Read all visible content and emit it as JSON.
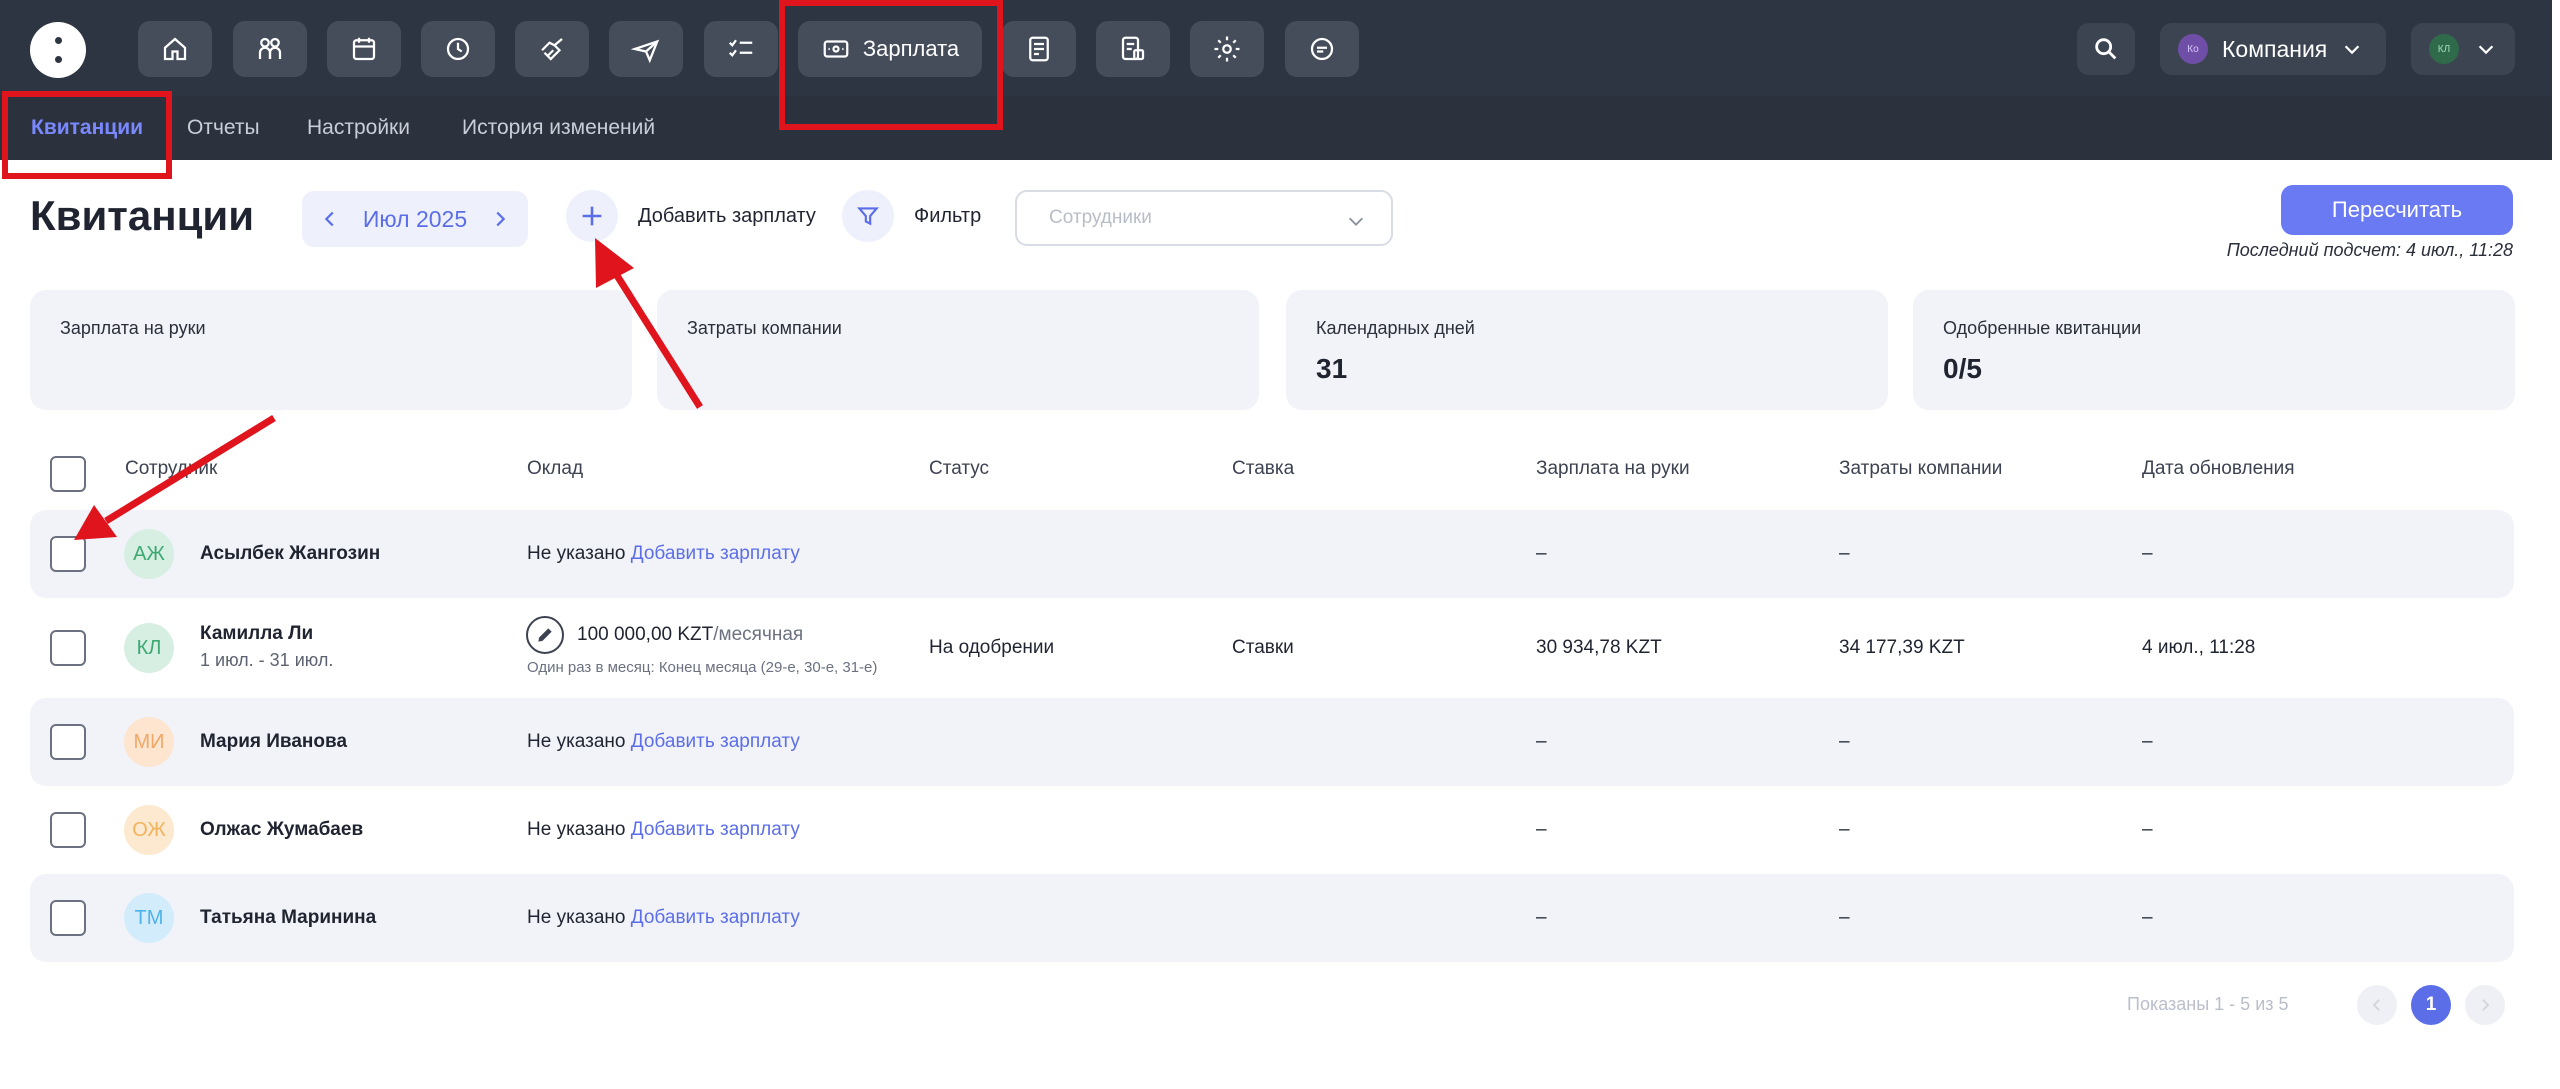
{
  "topnav": {
    "active_label": "Зарплата",
    "company_label": "Компания",
    "company_initials": "Ко",
    "user_initials": "КЛ",
    "icons": [
      "home-icon",
      "people-icon",
      "calendar-icon",
      "clock-icon",
      "handshake-icon",
      "plane-icon",
      "checklist-icon",
      "salary-icon",
      "document-icon",
      "reports-icon",
      "gear-icon",
      "chat-icon"
    ]
  },
  "subnav": {
    "tabs": [
      "Квитанции",
      "Отчеты",
      "Настройки",
      "История изменений"
    ]
  },
  "page": {
    "title": "Квитанции",
    "month": "Июл 2025",
    "add_salary": "Добавить зарплату",
    "filter": "Фильтр",
    "employees_placeholder": "Сотрудники",
    "recalc": "Пересчитать",
    "last_calc": "Последний подсчет: 4 июл., 11:28"
  },
  "stats": [
    {
      "label": "Зарплата на руки",
      "value": ""
    },
    {
      "label": "Затраты компании",
      "value": ""
    },
    {
      "label": "Календарных дней",
      "value": "31"
    },
    {
      "label": "Одобренные квитанции",
      "value": "0/5"
    }
  ],
  "table": {
    "headers": [
      "Сотрудник",
      "Оклад",
      "Статус",
      "Ставка",
      "Зарплата на руки",
      "Затраты компании",
      "Дата обновления"
    ],
    "rows": [
      {
        "initials": "АЖ",
        "name": "Асылбек Жангозин",
        "period": "",
        "salary_status": "Не указано",
        "salary_link": "Добавить зарплату",
        "salary_amount": "",
        "salary_unit": "",
        "salary_note": "",
        "status": "",
        "rate": "",
        "net": "–",
        "cost": "–",
        "updated": "–",
        "avatar_bg": "#d6efe2",
        "avatar_fg": "#3ea872"
      },
      {
        "initials": "КЛ",
        "name": "Камилла Ли",
        "period": "1 июл. - 31 июл.",
        "salary_status": "",
        "salary_link": "",
        "salary_amount": "100 000,00 KZT",
        "salary_unit": "/месячная",
        "salary_note": "Один раз в месяц: Конец месяца (29-е, 30-е, 31-е)",
        "status": "На одобрении",
        "rate": "Ставки",
        "net": "30 934,78 KZT",
        "cost": "34 177,39 KZT",
        "updated": "4 июл., 11:28",
        "avatar_bg": "#d6efe2",
        "avatar_fg": "#3ea872"
      },
      {
        "initials": "МИ",
        "name": "Мария Иванова",
        "period": "",
        "salary_status": "Не указано",
        "salary_link": "Добавить зарплату",
        "salary_amount": "",
        "salary_unit": "",
        "salary_note": "",
        "status": "",
        "rate": "",
        "net": "–",
        "cost": "–",
        "updated": "–",
        "avatar_bg": "#fde5cf",
        "avatar_fg": "#f0a868"
      },
      {
        "initials": "ОЖ",
        "name": "Олжас Жумабаев",
        "period": "",
        "salary_status": "Не указано",
        "salary_link": "Добавить зарплату",
        "salary_amount": "",
        "salary_unit": "",
        "salary_note": "",
        "status": "",
        "rate": "",
        "net": "–",
        "cost": "–",
        "updated": "–",
        "avatar_bg": "#fde9cf",
        "avatar_fg": "#f2b35d"
      },
      {
        "initials": "ТМ",
        "name": "Татьяна Маринина",
        "period": "",
        "salary_status": "Не указано",
        "salary_link": "Добавить зарплату",
        "salary_amount": "",
        "salary_unit": "",
        "salary_note": "",
        "status": "",
        "rate": "",
        "net": "–",
        "cost": "–",
        "updated": "–",
        "avatar_bg": "#d3ecfb",
        "avatar_fg": "#4fb2e8"
      }
    ]
  },
  "pagination": {
    "info": "Показаны 1 - 5 из 5",
    "current": "1"
  },
  "colors": {
    "accent": "#6a7af3",
    "topbar": "#2e3542",
    "highlight": "#e0141c"
  }
}
